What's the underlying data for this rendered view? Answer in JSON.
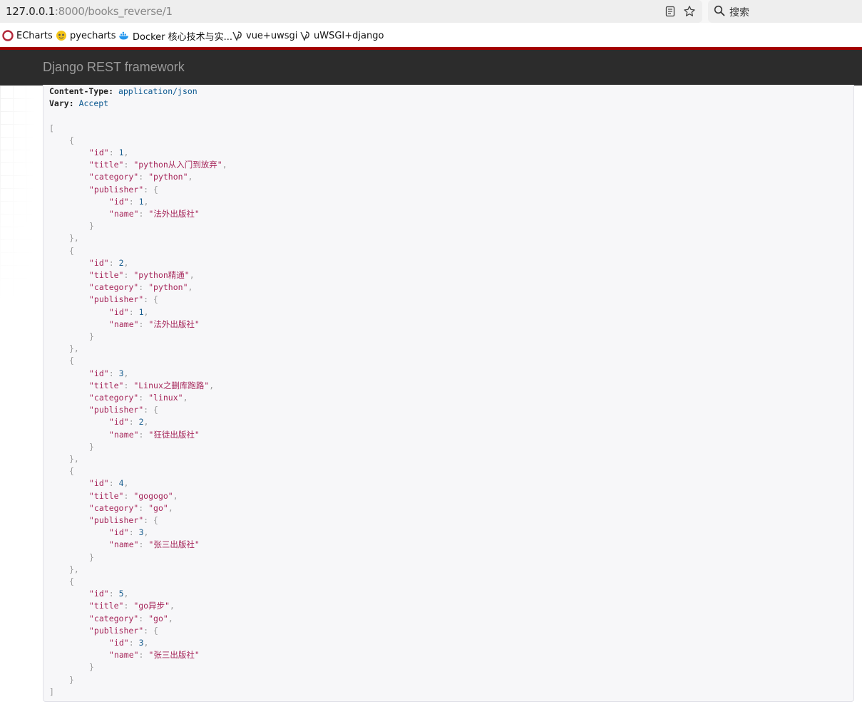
{
  "browser": {
    "url_host": "127.0.0.1",
    "url_path": ":8000/books_reverse/1",
    "search_placeholder": "搜索",
    "reader_icon": "reader-view-icon",
    "bookmark_star_icon": "star-icon"
  },
  "bookmarks": [
    {
      "label": "ECharts",
      "icon": "echarts-icon"
    },
    {
      "label": "pyecharts",
      "icon": "pyecharts-icon"
    },
    {
      "label": "Docker 核心技术与实...",
      "icon": "docker-icon"
    },
    {
      "label": "vue+uwsgi",
      "icon": "uwsgi-icon"
    },
    {
      "label": "uWSGI+django",
      "icon": "uwsgi-icon"
    }
  ],
  "navbar": {
    "brand": "Django REST framework"
  },
  "response": {
    "headers": [
      {
        "name": "Content-Type:",
        "value": "application/json"
      },
      {
        "name": "Vary:",
        "value": "Accept"
      }
    ],
    "books": [
      {
        "id": 1,
        "title": "python从入门到放弃",
        "category": "python",
        "publisher": {
          "id": 1,
          "name": "法外出版社"
        }
      },
      {
        "id": 2,
        "title": "python精通",
        "category": "python",
        "publisher": {
          "id": 1,
          "name": "法外出版社"
        }
      },
      {
        "id": 3,
        "title": "Linux之删库跑路",
        "category": "linux",
        "publisher": {
          "id": 2,
          "name": "狂徒出版社"
        }
      },
      {
        "id": 4,
        "title": "gogogo",
        "category": "go",
        "publisher": {
          "id": 3,
          "name": "张三出版社"
        }
      },
      {
        "id": 5,
        "title": "go异步",
        "category": "go",
        "publisher": {
          "id": 3,
          "name": "张三出版社"
        }
      }
    ]
  },
  "colors": {
    "navbar_bg": "#2c2c2c",
    "accent_red": "#a30000",
    "json_key": "#a6265a",
    "json_number": "#1b5f8f"
  }
}
